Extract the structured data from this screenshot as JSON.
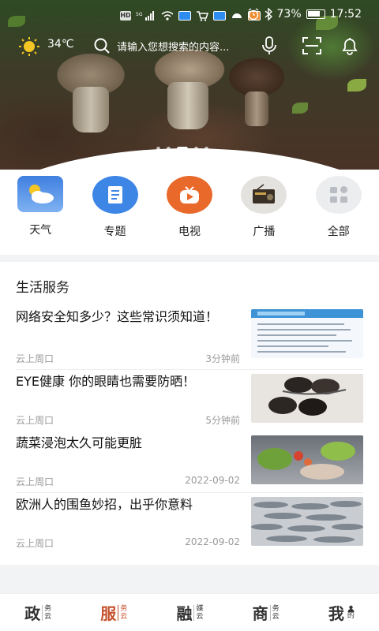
{
  "status_bar": {
    "network": "5G",
    "battery": "73%",
    "time": "17:52",
    "hd": "HD"
  },
  "header": {
    "temperature": "34℃",
    "search_placeholder": "请输入您想搜索的内容...",
    "banner_dots": 5,
    "banner_active_dot": 3
  },
  "quick_icons": [
    {
      "label": "天气",
      "icon": "weather-icon"
    },
    {
      "label": "专题",
      "icon": "topic-icon"
    },
    {
      "label": "电视",
      "icon": "tv-icon"
    },
    {
      "label": "广播",
      "icon": "radio-icon"
    },
    {
      "label": "全部",
      "icon": "grid-icon"
    }
  ],
  "services": {
    "title": "生活服务",
    "items": [
      {
        "title": "网络安全知多少？这些常识须知道！",
        "source": "云上周口",
        "time": "3分钟前"
      },
      {
        "title": "EYE健康 你的眼睛也需要防晒！",
        "source": "云上周口",
        "time": "5分钟前"
      },
      {
        "title": "蔬菜浸泡太久可能更脏",
        "source": "云上周口",
        "time": "2022-09-02"
      },
      {
        "title": "欧洲人的围鱼妙招，出乎你意料",
        "source": "云上周口",
        "time": "2022-09-02"
      }
    ]
  },
  "bottom_nav": [
    {
      "big": "政",
      "s1": "务",
      "s2": "云",
      "active": false
    },
    {
      "big": "服",
      "s1": "务",
      "s2": "云",
      "active": true
    },
    {
      "big": "融",
      "s1": "媒",
      "s2": "云",
      "active": false
    },
    {
      "big": "商",
      "s1": "务",
      "s2": "云",
      "active": false
    },
    {
      "big": "我",
      "s1": "",
      "s2": "的",
      "active": false
    }
  ],
  "colors": {
    "accent": "#c5512d",
    "tv": "#e8692a",
    "topic": "#3d86e6"
  }
}
